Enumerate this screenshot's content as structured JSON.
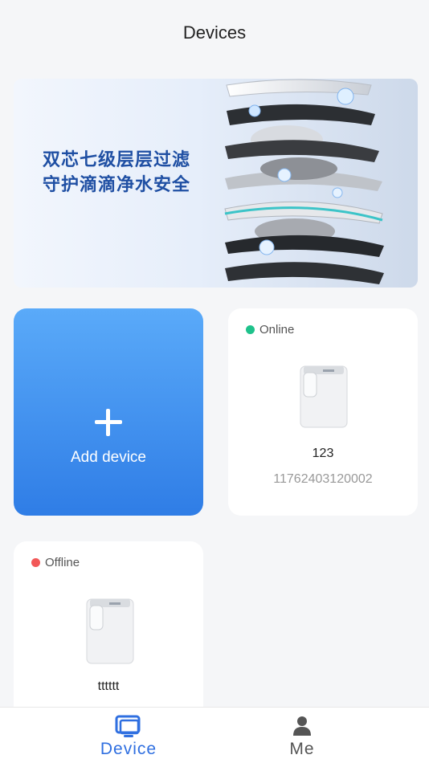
{
  "header": {
    "title": "Devices"
  },
  "banner": {
    "line1": "双芯七级层层过滤",
    "line2": "守护滴滴净水安全"
  },
  "add_card": {
    "label": "Add device",
    "plus_icon": "plus-icon"
  },
  "devices": [
    {
      "status": "Online",
      "status_color": "#1ec28b",
      "name": "123",
      "serial": "11762403120002"
    },
    {
      "status": "Offline",
      "status_color": "#f25858",
      "name": "tttttt",
      "serial": ""
    }
  ],
  "tabbar": {
    "items": [
      {
        "label": "Device",
        "icon": "monitor-icon",
        "active": true,
        "color": "#2f6fe0"
      },
      {
        "label": "Me",
        "icon": "person-icon",
        "active": false,
        "color": "#555555"
      }
    ]
  }
}
